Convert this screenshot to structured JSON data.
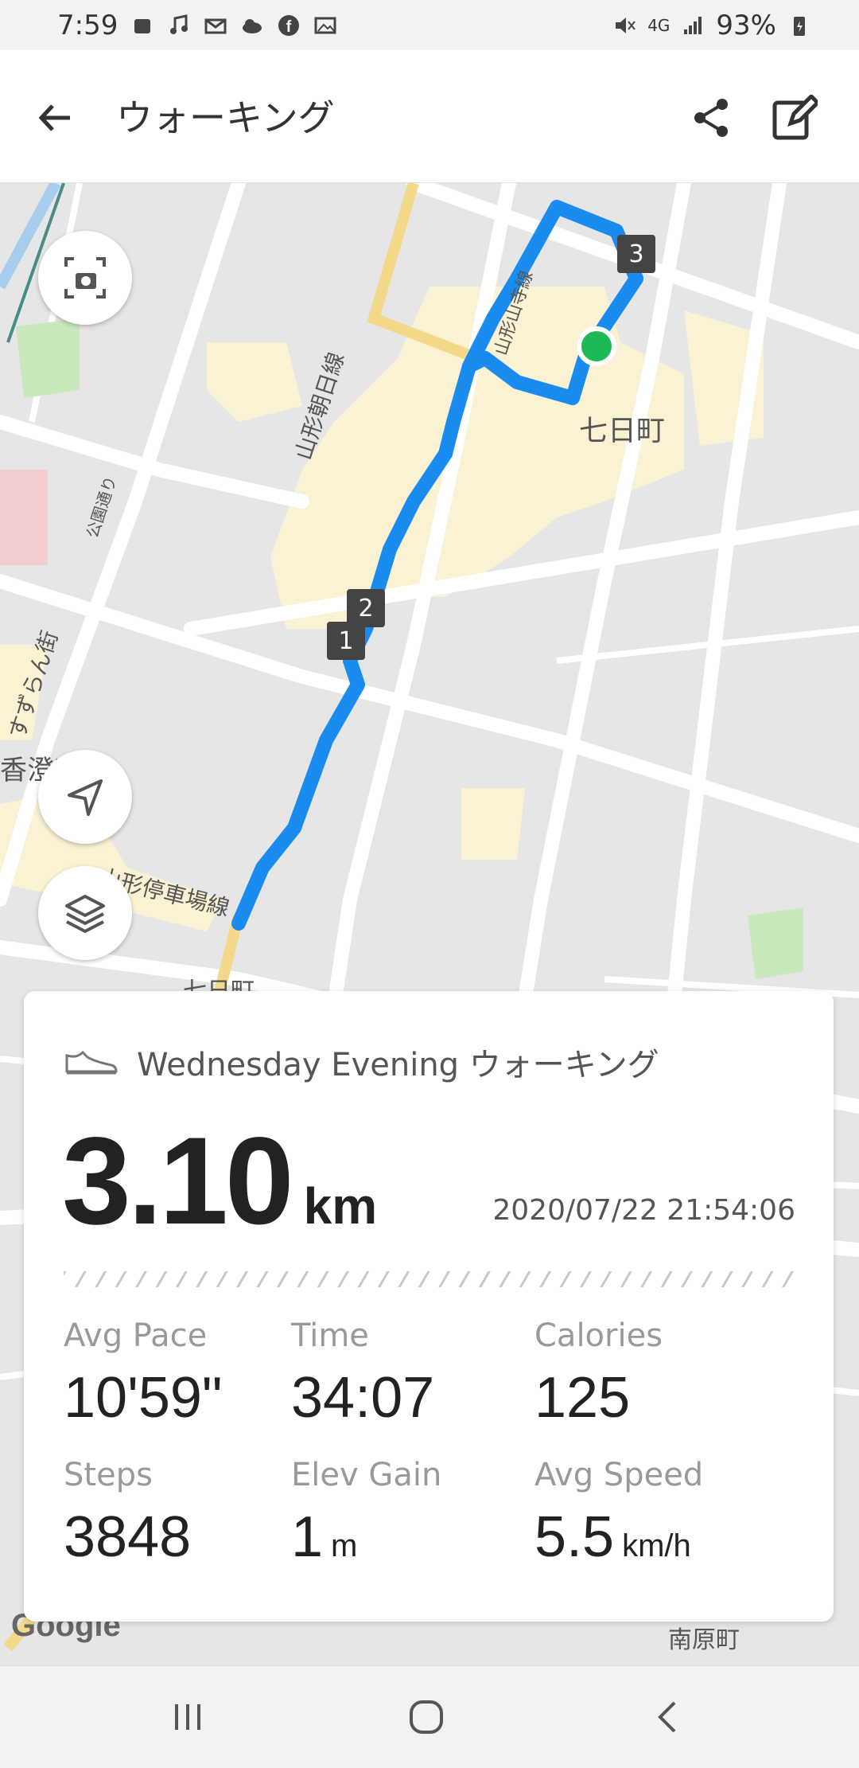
{
  "status_bar": {
    "time": "7:59",
    "network": "4G",
    "battery": "93%"
  },
  "app_bar": {
    "title": "ウォーキング"
  },
  "map": {
    "labels": {
      "district": "七日町",
      "line_asahi": "山形朝日線",
      "line_station": "山形停車場線",
      "line_park": "公園通り",
      "suzuran": "すずらん街",
      "kozumi": "香澄町",
      "nanokamachi_bottom": "七日町",
      "minamihara": "南原町",
      "yamagata_line": "山形山寺線"
    },
    "markers": [
      "1",
      "2",
      "3"
    ],
    "attribution": "Google",
    "route_color": "#1a8cf0",
    "end_point_color": "#1db954"
  },
  "summary": {
    "activity_title": "Wednesday Evening ウォーキング",
    "distance": "3.10",
    "distance_unit": "km",
    "datetime": "2020/07/22 21:54:06",
    "stats": {
      "avg_pace": {
        "label": "Avg Pace",
        "value": "10'59\""
      },
      "time": {
        "label": "Time",
        "value": "34:07"
      },
      "calories": {
        "label": "Calories",
        "value": "125"
      },
      "steps": {
        "label": "Steps",
        "value": "3848"
      },
      "elev_gain": {
        "label": "Elev Gain",
        "value": "1",
        "unit": "m"
      },
      "avg_speed": {
        "label": "Avg Speed",
        "value": "5.5",
        "unit": "km/h"
      }
    }
  }
}
